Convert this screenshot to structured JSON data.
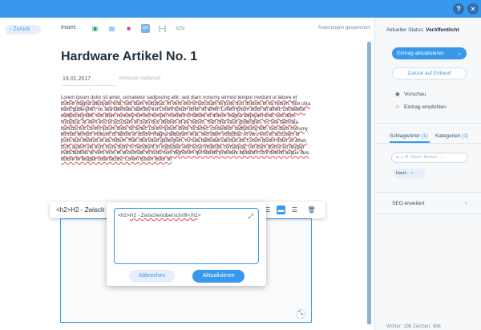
{
  "colors": {
    "accent": "#3899ec",
    "topbar": "#3899ec",
    "spellcheck": "#e04a4a"
  },
  "topbar": {
    "help_label": "?",
    "close_label": "×"
  },
  "editor": {
    "back_label": "Zurück",
    "insert_label": "Insert:",
    "insert_icons": [
      "image-icon",
      "gallery-icon",
      "video-icon",
      "gif-icon",
      "divider-icon",
      "code-icon"
    ],
    "saved_status": "Änderungen gespeichert",
    "title": "Hardware Artikel No. 1",
    "date": "19.01.2017",
    "author_placeholder": "Verfasser (optional)",
    "body_text": "Lorem ipsum dolor sit amet, consetetur sadipscing elitr, sed diam nonumy eirmod tempor invidunt ut labore et dolore magna aliquyam erat, sed diam voluptua. At vero eos et accusam et justo duo dolores et ea rebum. Stet clita kasd gubergren, no sea takimata sanctus est Lorem ipsum dolor sit amet. Lorem ipsum dolor sit amet, consetetur sadipscing elitr, sed diam nonumy eirmod tempor invidunt ut labore et dolore magna aliquyam erat, sed diam voluptua. At vero eos et accusam et justo duo dolores et ea rebum. Stet clita kasd gubergren, no sea takimata sanctus est Lorem ipsum dolor sit amet. Lorem ipsum dolor sit amet, consetetur sadipscing elitr, sed diam nonumy eirmod tempor invidunt ut labore et dolore magna aliquyam erat, sed diam voluptua. At vero eos et accusam et justo duo dolores et ea rebum. Stet clita kasd gubergren, no sea takimata sanctus est Lorem ipsum dolor sit amet. Duis autem vel eum iriure dolor in hendrerit in vulputate velit esse molestie consequat, vel illum dolore eu feugiat nulla facilisis at vero eros et accumsan et iusto odio dignissim qui blandit praesent luptatum zzril delenit augue duis dolore te feugait nulla facilisi. Lorem ipsum dolor sit"
  },
  "toolbar": {
    "html_snippet": "<h2>H2 - Zwisch"
  },
  "popup": {
    "code_open": "<h2>",
    "code_middle": "H2 - Zwischenüberschrift</",
    "code_tag": "h2",
    "code_close": ">",
    "cancel_label": "Abbrechen",
    "update_label": "Aktualisieren"
  },
  "sidebar": {
    "status_label": "Aktueller Status:",
    "status_value": "Veröffentlicht",
    "publish_label": "Eintrag aktualisieren",
    "draft_label": "Zurück auf Entwurf",
    "preview_label": "Vorschau",
    "recommend_label": "Eintrag empfehlen",
    "tab_tags": "Schlagwörter",
    "tab_tags_count": "(1)",
    "tab_categories": "Kategorien",
    "tab_categories_count": "(1)",
    "tag_placeholder": "z. B. Sport, Reisen, ...",
    "tag_chip": "Hard...",
    "seo_label": "SEO erweitert",
    "counts": "Wörter: 198  Zeichen: 988"
  }
}
